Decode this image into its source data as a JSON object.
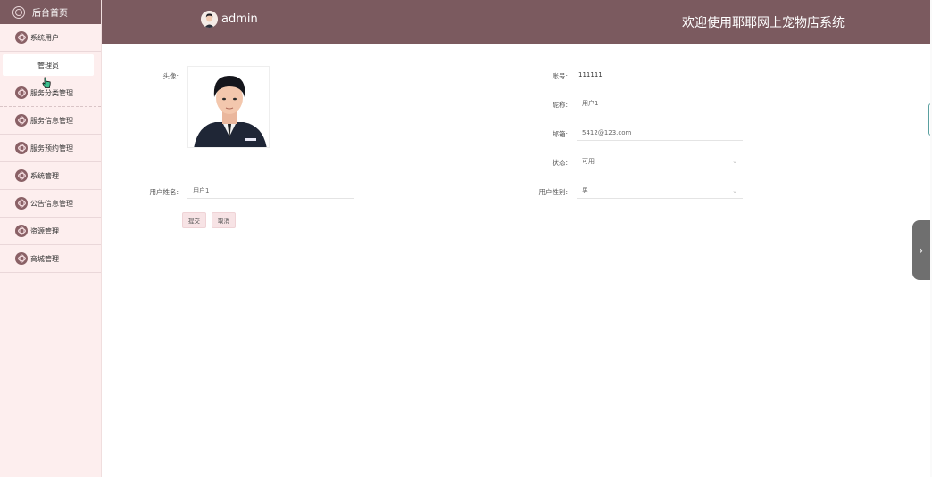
{
  "sidebar": {
    "home": "后台首页",
    "items": [
      {
        "label": "系统用户"
      },
      {
        "label": "服务分类管理"
      },
      {
        "label": "服务信息管理"
      },
      {
        "label": "服务预约管理"
      },
      {
        "label": "系统管理"
      },
      {
        "label": "公告信息管理"
      },
      {
        "label": "资源管理"
      },
      {
        "label": "商城管理"
      }
    ],
    "sub_item": "管理员"
  },
  "header": {
    "user_name": "admin",
    "system_title": "欢迎使用耶耶网上宠物店系统"
  },
  "form": {
    "avatar_label": "头像:",
    "account_label": "账号:",
    "account_value": "111111",
    "nickname_label": "昵称:",
    "nickname_value": "用户1",
    "email_label": "邮箱:",
    "email_value": "5412@123.com",
    "status_label": "状态:",
    "status_value": "可用",
    "username_label": "用户姓名:",
    "username_value": "用户1",
    "gender_label": "用户性别:",
    "gender_value": "男",
    "submit_label": "提交",
    "cancel_label": "取消"
  },
  "colors": {
    "header_bg": "#7b5a5f",
    "sidebar_bg": "#fdeeee",
    "button_bg": "#f7e3e5"
  }
}
